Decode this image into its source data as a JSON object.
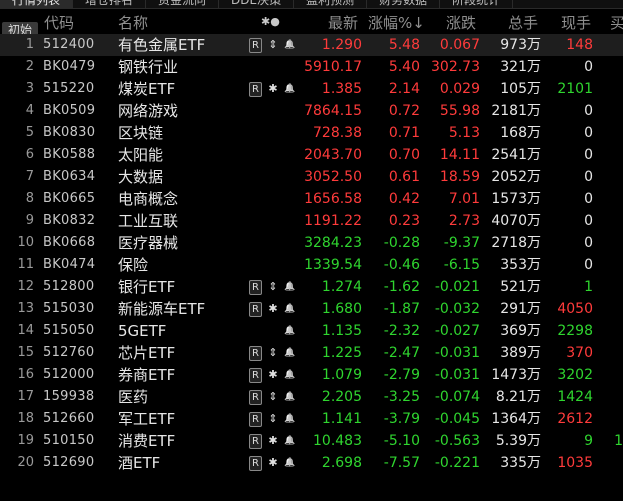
{
  "tabs": [
    "行情列表",
    "增仓排名",
    "资金流向",
    "DDE决策",
    "盈利预测",
    "财务数据",
    "阶段统计"
  ],
  "header": {
    "reset_label": "初始",
    "code": "代码",
    "name": "名称",
    "tags": "✱●",
    "price": "最新",
    "change_pct": "涨幅%↓",
    "change": "涨跌",
    "volume": "总手",
    "now_vol": "现手",
    "extra": "买"
  },
  "rows": [
    {
      "idx": "1",
      "code": "512400",
      "name": "有色金属ETF",
      "r": true,
      "sym": "⇕",
      "bell": true,
      "price": "1.290",
      "chg_pct": "5.48",
      "chg": "0.067",
      "vol": "973",
      "unit": "万",
      "now": "148",
      "now_color": "red",
      "extra": "",
      "dir": "up",
      "selected": true
    },
    {
      "idx": "2",
      "code": "BK0479",
      "name": "钢铁行业",
      "r": false,
      "sym": "",
      "bell": false,
      "price": "5910.17",
      "chg_pct": "5.40",
      "chg": "302.73",
      "vol": "321",
      "unit": "万",
      "now": "0",
      "now_color": "white",
      "extra": "",
      "dir": "up"
    },
    {
      "idx": "3",
      "code": "515220",
      "name": "煤炭ETF",
      "r": true,
      "sym": "✱",
      "bell": true,
      "price": "1.385",
      "chg_pct": "2.14",
      "chg": "0.029",
      "vol": "105",
      "unit": "万",
      "now": "2101",
      "now_color": "green",
      "extra": "",
      "dir": "up"
    },
    {
      "idx": "4",
      "code": "BK0509",
      "name": "网络游戏",
      "r": false,
      "sym": "",
      "bell": false,
      "price": "7864.15",
      "chg_pct": "0.72",
      "chg": "55.98",
      "vol": "2181",
      "unit": "万",
      "now": "0",
      "now_color": "white",
      "extra": "",
      "dir": "up"
    },
    {
      "idx": "5",
      "code": "BK0830",
      "name": "区块链",
      "r": false,
      "sym": "",
      "bell": false,
      "price": "728.38",
      "chg_pct": "0.71",
      "chg": "5.13",
      "vol": "168",
      "unit": "万",
      "now": "0",
      "now_color": "white",
      "extra": "",
      "dir": "up"
    },
    {
      "idx": "6",
      "code": "BK0588",
      "name": "太阳能",
      "r": false,
      "sym": "",
      "bell": false,
      "price": "2043.70",
      "chg_pct": "0.70",
      "chg": "14.11",
      "vol": "2541",
      "unit": "万",
      "now": "0",
      "now_color": "white",
      "extra": "",
      "dir": "up"
    },
    {
      "idx": "7",
      "code": "BK0634",
      "name": "大数据",
      "r": false,
      "sym": "",
      "bell": false,
      "price": "3052.50",
      "chg_pct": "0.61",
      "chg": "18.59",
      "vol": "2052",
      "unit": "万",
      "now": "0",
      "now_color": "white",
      "extra": "",
      "dir": "up"
    },
    {
      "idx": "8",
      "code": "BK0665",
      "name": "电商概念",
      "r": false,
      "sym": "",
      "bell": false,
      "price": "1656.58",
      "chg_pct": "0.42",
      "chg": "7.01",
      "vol": "1573",
      "unit": "万",
      "now": "0",
      "now_color": "white",
      "extra": "",
      "dir": "up"
    },
    {
      "idx": "9",
      "code": "BK0832",
      "name": "工业互联",
      "r": false,
      "sym": "",
      "bell": false,
      "price": "1191.22",
      "chg_pct": "0.23",
      "chg": "2.73",
      "vol": "4070",
      "unit": "万",
      "now": "0",
      "now_color": "white",
      "extra": "",
      "dir": "up"
    },
    {
      "idx": "10",
      "code": "BK0668",
      "name": "医疗器械",
      "r": false,
      "sym": "",
      "bell": false,
      "price": "3284.23",
      "chg_pct": "-0.28",
      "chg": "-9.37",
      "vol": "2718",
      "unit": "万",
      "now": "0",
      "now_color": "white",
      "extra": "",
      "dir": "down"
    },
    {
      "idx": "11",
      "code": "BK0474",
      "name": "保险",
      "r": false,
      "sym": "",
      "bell": false,
      "price": "1339.54",
      "chg_pct": "-0.46",
      "chg": "-6.15",
      "vol": "353",
      "unit": "万",
      "now": "0",
      "now_color": "white",
      "extra": "",
      "dir": "down"
    },
    {
      "idx": "12",
      "code": "512800",
      "name": "银行ETF",
      "r": true,
      "sym": "⇕",
      "bell": true,
      "price": "1.274",
      "chg_pct": "-1.62",
      "chg": "-0.021",
      "vol": "521",
      "unit": "万",
      "now": "1",
      "now_color": "green",
      "extra": "",
      "dir": "down"
    },
    {
      "idx": "13",
      "code": "515030",
      "name": "新能源车ETF",
      "r": true,
      "sym": "✱",
      "bell": true,
      "price": "1.680",
      "chg_pct": "-1.87",
      "chg": "-0.032",
      "vol": "291",
      "unit": "万",
      "now": "4050",
      "now_color": "red",
      "extra": "",
      "dir": "down"
    },
    {
      "idx": "14",
      "code": "515050",
      "name": "5GETF",
      "r": false,
      "sym": "",
      "bell": true,
      "price": "1.135",
      "chg_pct": "-2.32",
      "chg": "-0.027",
      "vol": "369",
      "unit": "万",
      "now": "2298",
      "now_color": "green",
      "extra": "",
      "dir": "down"
    },
    {
      "idx": "15",
      "code": "512760",
      "name": "芯片ETF",
      "r": true,
      "sym": "⇕",
      "bell": true,
      "price": "1.225",
      "chg_pct": "-2.47",
      "chg": "-0.031",
      "vol": "389",
      "unit": "万",
      "now": "370",
      "now_color": "red",
      "extra": "",
      "dir": "down"
    },
    {
      "idx": "16",
      "code": "512000",
      "name": "券商ETF",
      "r": true,
      "sym": "✱",
      "bell": true,
      "price": "1.079",
      "chg_pct": "-2.79",
      "chg": "-0.031",
      "vol": "1473",
      "unit": "万",
      "now": "3202",
      "now_color": "green",
      "extra": "",
      "dir": "down"
    },
    {
      "idx": "17",
      "code": "159938",
      "name": "医药",
      "r": true,
      "sym": "⇕",
      "bell": true,
      "price": "2.205",
      "chg_pct": "-3.25",
      "chg": "-0.074",
      "vol": "8.21",
      "unit": "万",
      "now": "1424",
      "now_color": "green",
      "extra": "",
      "dir": "down"
    },
    {
      "idx": "18",
      "code": "512660",
      "name": "军工ETF",
      "r": true,
      "sym": "⇕",
      "bell": true,
      "price": "1.141",
      "chg_pct": "-3.79",
      "chg": "-0.045",
      "vol": "1364",
      "unit": "万",
      "now": "2612",
      "now_color": "red",
      "extra": "",
      "dir": "down"
    },
    {
      "idx": "19",
      "code": "510150",
      "name": "消费ETF",
      "r": true,
      "sym": "✱",
      "bell": true,
      "price": "10.483",
      "chg_pct": "-5.10",
      "chg": "-0.563",
      "vol": "5.39",
      "unit": "万",
      "now": "9",
      "now_color": "green",
      "extra": "1",
      "dir": "down"
    },
    {
      "idx": "20",
      "code": "512690",
      "name": "酒ETF",
      "r": true,
      "sym": "✱",
      "bell": true,
      "price": "2.698",
      "chg_pct": "-7.57",
      "chg": "-0.221",
      "vol": "335",
      "unit": "万",
      "now": "1035",
      "now_color": "red",
      "extra": "",
      "dir": "down"
    }
  ],
  "icons": {
    "r_badge": "R",
    "bell": "bell-icon"
  },
  "colors": {
    "up": "#ff3b3b",
    "down": "#2fd52f",
    "now_red": "#ff3b3b",
    "now_green": "#2fd52f",
    "background": "#000000"
  }
}
